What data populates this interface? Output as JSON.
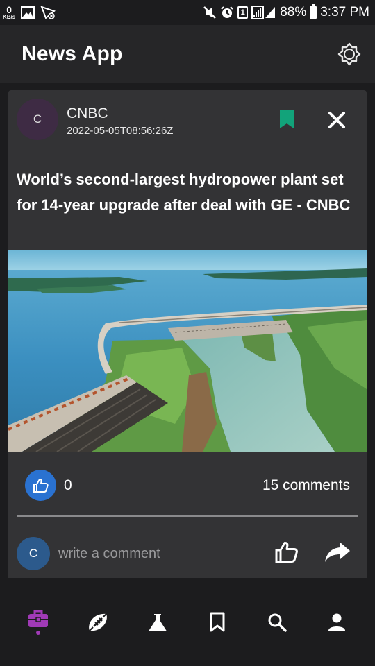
{
  "status_bar": {
    "net_speed_value": "0",
    "net_speed_unit": "KB/s",
    "sim_label": "1",
    "battery": "88%",
    "time": "3:37 PM",
    "icons": [
      "image-icon",
      "no-signal-icon",
      "mute-icon",
      "alarm-icon",
      "signal-icon",
      "battery-icon"
    ]
  },
  "app_bar": {
    "title": "News App",
    "theme_icon": "brightness-icon"
  },
  "article": {
    "avatar_letter": "C",
    "source": "CNBC",
    "published": "2022-05-05T08:56:26Z",
    "headline": "World’s second-largest hydropower plant set for 14-year upgrade after deal with GE - CNBC",
    "bookmarked": true,
    "like_count": "0",
    "comments_label": "15 comments",
    "comment_avatar_letter": "C",
    "comment_placeholder": "write a comment"
  },
  "colors": {
    "background": "#1c1c1e",
    "app_bar": "#262628",
    "card": "#333335",
    "bookmark": "#12a37a",
    "like_blue": "#2a72d1",
    "nav_active": "#a03ab6"
  },
  "bottom_nav": {
    "items": [
      {
        "icon": "briefcase-icon",
        "active": true
      },
      {
        "icon": "football-icon",
        "active": false
      },
      {
        "icon": "flask-icon",
        "active": false
      },
      {
        "icon": "bookmark-icon",
        "active": false
      },
      {
        "icon": "search-icon",
        "active": false
      },
      {
        "icon": "person-icon",
        "active": false
      }
    ]
  }
}
